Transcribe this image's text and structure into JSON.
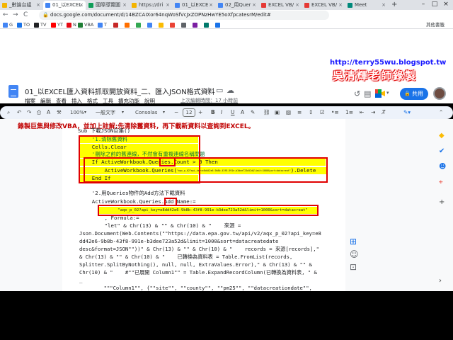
{
  "browser": {
    "tabs": [
      {
        "label": "_數論台組",
        "color": "#f4b400"
      },
      {
        "label": "01_以EXCEL",
        "color": "#4285f4",
        "active": true
      },
      {
        "label": "國際導覽圖",
        "color": "#0f9d58"
      },
      {
        "label": "https://dri",
        "color": "#f4b400"
      },
      {
        "label": "01_以EXCE",
        "color": "#4285f4"
      },
      {
        "label": "02_用Quer",
        "color": "#4285f4"
      },
      {
        "label": "EXCEL VB/",
        "color": "#e53935"
      },
      {
        "label": "EXCEL VB/",
        "color": "#e53935"
      },
      {
        "label": "Meet",
        "color": "#00897b"
      }
    ],
    "url": "docs.google.com/document/d/14BZCAIXor64nqWoSfVcJxZOPNzHwYE5oXfpcatesrM/edit#",
    "bookmarks": [
      "G",
      "TO",
      "TV",
      "YT",
      "N",
      "VBA",
      "T",
      "",
      "",
      "",
      "",
      "",
      "",
      "",
      "",
      "",
      "",
      "",
      "其他書籤"
    ],
    "nav": {
      "back": "←",
      "forward": "→",
      "reload": "C"
    }
  },
  "watermark": {
    "url": "http://terry55wu.blogspot.tw",
    "name": "吳清輝老師錄製"
  },
  "docs": {
    "title": "01_以EXCEL匯入資料抓取開放資料_二、匯入JSON格式資料",
    "menu": [
      "檔案",
      "編輯",
      "查看",
      "插入",
      "格式",
      "工具",
      "擴充功能",
      "說明"
    ],
    "last_edit": "上次編輯時間：17 小時前",
    "share_label": "共用",
    "share_icon": "lock-icon",
    "toolbar": {
      "zoom": "100%",
      "style": "一般文字",
      "font": "Consolas",
      "font_size": "12"
    }
  },
  "document": {
    "heading": "錄製巨集與修改VBA，並加上註解;先清除舊資料，再下載新資料以查詢到EXCEL。",
    "lines": [
      "Sub 下載JSON巨集()",
      "    '1.清除舊資料",
      "    Cells.Clear",
      "    '刪除之前的舊連線，不然會有重複連線名稱問題",
      "    If ActiveWorkbook.Queries.Count > 0 Then",
      "        ActiveWorkbook.Queries(\"aqx_p_02?api_key=e8dd42e6-9b8b-43f8-991e-b3dee723a52d&limit=1000&sort=datacreat\").Delete",
      "    End If",
      "",
      "    '2.用Queries物件的Add方法下載資料",
      "    ActiveWorkbook.Queries.Add Name:=",
      "        \"aqx_p_02?api_key=e8dd42e6-9b8b-43f8-991e-b3dee723a52d&limit=1000&sort=datacreat\"",
      "        , Formula:=",
      "        \"let\" & Chr(13) & \"\" & Chr(10) & \"    來源 =",
      "Json.Document(Web.Contents(\"\"https://data.epa.gov.tw/api/v2/aqx_p_02?api_key=e8",
      "dd42e6-9b8b-43f8-991e-b3dee723a52d&limit=1000&sort=datacreatedate",
      "desc&format=JSON\"\"))\" & Chr(13) & \"\" & Chr(10) & \"    records = 來源[records],\"",
      "& Chr(13) & \"\" & Chr(10) & \"    已轉換為資料表 = Table.FromList(records,",
      "Splitter.SplitByNothing(), null, null, ExtraValues.Error),\" & Chr(13) & \"\" &",
      "Chr(10) & \"    #\"\"已展開 Column1\"\" = Table.ExpandRecordColumn(已轉換為資料表, \" &",
      "_",
      "        \"\"\"Column1\"\", {\"\"site\"\", \"\"county\"\", \"\"pm25\"\", \"\"datacreationdate\"\","
    ]
  }
}
